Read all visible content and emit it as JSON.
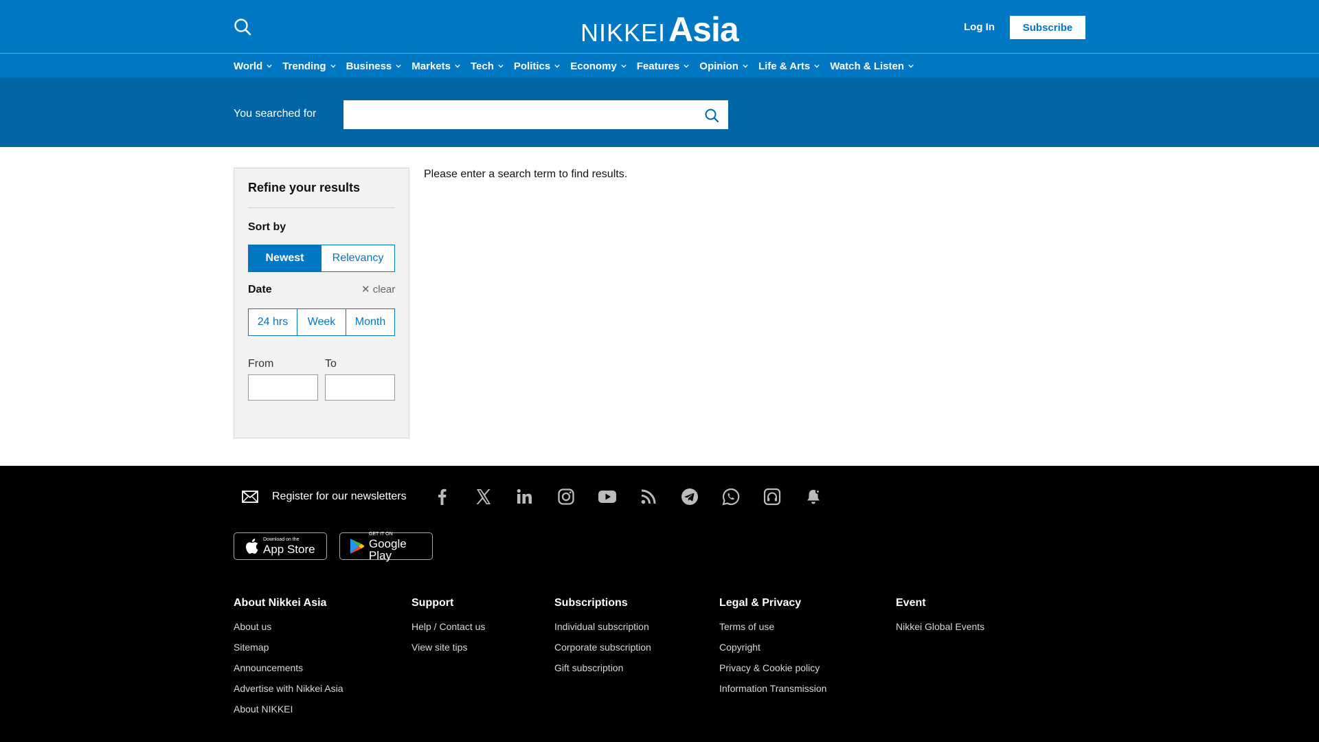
{
  "header": {
    "logo_part1": "NIKKEI",
    "logo_part2": "Asia",
    "login_label": "Log In",
    "subscribe_label": "Subscribe",
    "search_icon": "search-icon"
  },
  "nav": {
    "items": [
      {
        "label": "World"
      },
      {
        "label": "Trending"
      },
      {
        "label": "Business"
      },
      {
        "label": "Markets"
      },
      {
        "label": "Tech"
      },
      {
        "label": "Politics"
      },
      {
        "label": "Economy"
      },
      {
        "label": "Features"
      },
      {
        "label": "Opinion"
      },
      {
        "label": "Life & Arts"
      },
      {
        "label": "Watch & Listen"
      }
    ]
  },
  "search": {
    "label": "You searched for",
    "value": "",
    "placeholder": ""
  },
  "refine": {
    "title": "Refine your results",
    "sort_label": "Sort by",
    "sort_options": [
      "Newest",
      "Relevancy"
    ],
    "sort_selected": "Newest",
    "date_label": "Date",
    "clear_label": "clear",
    "date_options": [
      "24 hrs",
      "Week",
      "Month"
    ],
    "from_label": "From",
    "to_label": "To",
    "from_value": "",
    "to_value": ""
  },
  "results": {
    "message": "Please enter a search term to find results."
  },
  "footer": {
    "newsletter_label": "Register for our newsletters",
    "social_icons": [
      "facebook-icon",
      "x-icon",
      "linkedin-icon",
      "instagram-icon",
      "youtube-icon",
      "rss-icon",
      "telegram-icon",
      "whatsapp-icon",
      "podcast-icon",
      "notification-bell-icon"
    ],
    "app_store": {
      "small": "Download on the",
      "big": "App Store"
    },
    "google_play": {
      "small": "GET IT ON",
      "big": "Google Play"
    },
    "columns": [
      {
        "title": "About Nikkei Asia",
        "links": [
          "About us",
          "Sitemap",
          "Announcements",
          "Advertise with Nikkei Asia",
          "About NIKKEI"
        ]
      },
      {
        "title": "Support",
        "links": [
          "Help / Contact us",
          "View site tips"
        ]
      },
      {
        "title": "Subscriptions",
        "links": [
          "Individual subscription",
          "Corporate subscription",
          "Gift subscription"
        ]
      },
      {
        "title": "Legal & Privacy",
        "links": [
          "Terms of use",
          "Copyright",
          "Privacy & Cookie policy",
          "Information Transmission"
        ]
      },
      {
        "title": "Event",
        "links": [
          "Nikkei Global Events"
        ]
      }
    ]
  },
  "colors": {
    "brand_blue": "#0077c2",
    "search_band": "#0065a5",
    "footer_bg": "#000000"
  }
}
